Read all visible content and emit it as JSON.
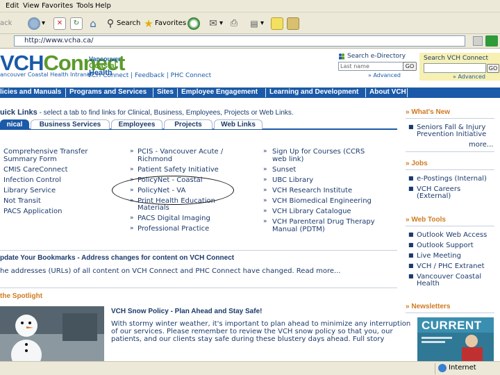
{
  "browser": {
    "menu": [
      "Edit",
      "View",
      "Favorites",
      "Tools",
      "Help"
    ],
    "toolbar": {
      "search_label": "Search",
      "favorites_label": "Favorites"
    },
    "address": "http://www.vcha.ca/",
    "status": "Internet"
  },
  "header": {
    "logo_main": "VCH",
    "logo_accent": "Connect",
    "logo_sub": "ancouver Coastal Health Intranet",
    "badge": [
      "Vancouver",
      "Coastal",
      "Health"
    ],
    "links": "VCH Connect | Feedback | PHC Connect",
    "edirectory": {
      "title": "Search e-Directory",
      "placeholder": "Last name",
      "go": "GO",
      "advanced": "» Advanced"
    },
    "vch_search": {
      "title": "Search VCH Connect",
      "go": "GO",
      "advanced": "» Advanced"
    }
  },
  "nav": [
    "licies and Manuals",
    "Programs and Services",
    "Sites",
    "Employee Engagement",
    "Learning and Development",
    "About VCH"
  ],
  "quick_links": {
    "title_bold": "uick Links",
    "title_rest": " - select a tab to find links for Clinical, Business, Employees, Projects or Web Links.",
    "tabs": [
      "nical",
      "Business Services",
      "Employees",
      "Projects",
      "Web Links"
    ],
    "col1": [
      "Comprehensive Transfer",
      "Summary Form",
      "CMIS CareConnect",
      "Infection Control",
      "Library Service",
      "Not Transit",
      "PACS Application"
    ],
    "col2": [
      "PCIS - Vancouver Acute /",
      "Richmond",
      "Patient Safety Initiative",
      "PolicyNet - Coastal",
      "PolicyNet - VA",
      "Print Health Education",
      "Materials",
      "PACS Digital Imaging",
      "Professional Practice"
    ],
    "col3": [
      "Sign Up for Courses (CCRS",
      "web link)",
      "Sunset",
      "UBC Library",
      "VCH Research Institute",
      "VCH Biomedical Engineering",
      "VCH Library Catalogue",
      "VCH Parenteral Drug Therapy",
      "Manual (PDTM)"
    ]
  },
  "bookmarks": {
    "title": "pdate Your Bookmarks - Address changes for content on VCH Connect",
    "text": "he addresses (URLs) of all content on VCH Connect and PHC Connect have changed.  Read more..."
  },
  "spotlight": {
    "title": "the Spotlight",
    "headline": "VCH Snow Policy - Plan Ahead and Stay Safe!",
    "lines": [
      "With stormy winter weather, it's important to plan ahead to minimize any interruption",
      "of our services. Please remember to review the VCH snow policy so that you, our",
      "patients, and our clients stay safe during these blustery days ahead. Full story"
    ]
  },
  "sidebar": {
    "whats_new": {
      "title": "» What's New",
      "items": [
        "Seniors Fall & Injury",
        "Prevention Initiative"
      ],
      "more": "more..."
    },
    "jobs": {
      "title": "» Jobs",
      "items": [
        "e-Postings (Internal)",
        "VCH Careers",
        "(External)"
      ]
    },
    "web_tools": {
      "title": "» Web Tools",
      "items": [
        "Outlook Web Access",
        "Outlook Support",
        "Live Meeting",
        "VCH / PHC Extranet",
        "Vancouver Coastal",
        "Health"
      ]
    },
    "newsletters": {
      "title": "» Newsletters",
      "magazine": "CURRENT"
    }
  },
  "colors": {
    "brand_blue": "#1b5aa8",
    "brand_green": "#5b9b2a",
    "accent_orange": "#d07a20",
    "search_bg": "#f6f0b3"
  }
}
